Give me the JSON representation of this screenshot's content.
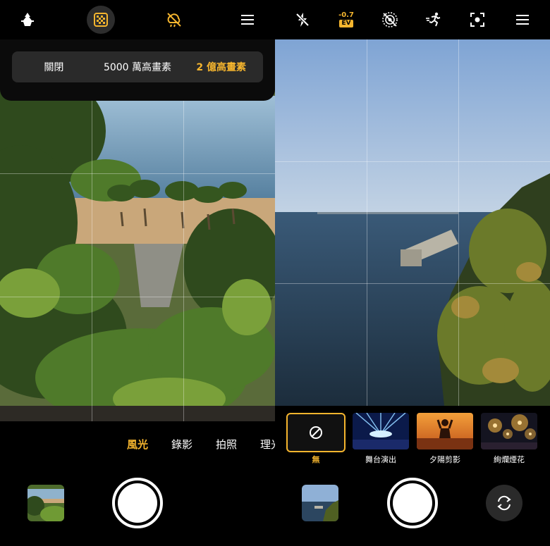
{
  "left_screen": {
    "top_icons": [
      "grid-toggle-icon",
      "hdr-icon",
      "flash-off-icon",
      "menu-icon"
    ],
    "resolution_options": [
      {
        "label": "關閉",
        "active": false
      },
      {
        "label": "5000 萬高畫素",
        "active": false
      },
      {
        "label": "2 億高畫素",
        "active": true
      }
    ],
    "modes": [
      {
        "label": "風光",
        "active": true
      },
      {
        "label": "錄影",
        "active": false
      },
      {
        "label": "拍照",
        "active": false
      },
      {
        "label": "理光",
        "active": false
      }
    ]
  },
  "right_screen": {
    "top_icons": [
      "flash-off-icon",
      "exposure-icon",
      "live-photo-off-icon",
      "motion-icon",
      "focus-icon",
      "menu-icon"
    ],
    "ev_value": "-0.7",
    "ev_label": "EV",
    "filters": [
      {
        "label": "無",
        "active": true
      },
      {
        "label": "舞台演出",
        "active": false
      },
      {
        "label": "夕陽剪影",
        "active": false
      },
      {
        "label": "絢爛煙花",
        "active": false
      }
    ]
  },
  "colors": {
    "accent": "#f5b52e",
    "background": "#000000",
    "segment_bg": "#2a2a2a"
  }
}
